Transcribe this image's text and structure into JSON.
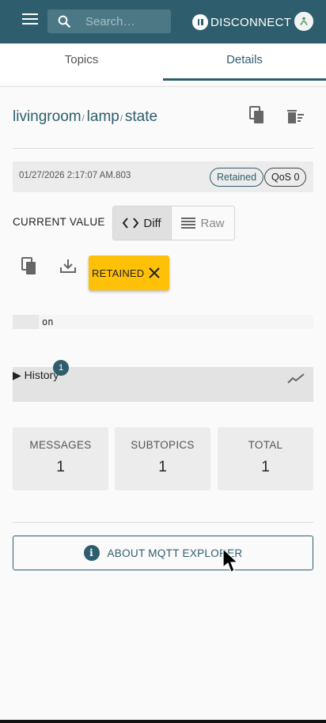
{
  "header": {
    "search_placeholder": "Search…",
    "disconnect_label": "DISCONNECT"
  },
  "tabs": [
    {
      "label": "Topics",
      "active": false
    },
    {
      "label": "Details",
      "active": true
    }
  ],
  "topic": {
    "segments": [
      "livingroom",
      "lamp",
      "state"
    ],
    "separator": "/"
  },
  "message": {
    "timestamp": "01/27/2026 2:17:07 AM.803",
    "retained_chip": "Retained",
    "qos_chip": "QoS 0"
  },
  "value_section": {
    "label": "CURRENT VALUE",
    "diff_label": "Diff",
    "raw_label": "Raw",
    "retained_button": "RETAINED",
    "value": "on"
  },
  "history": {
    "label": "History",
    "count": "1"
  },
  "stats": [
    {
      "title": "MESSAGES",
      "value": "1"
    },
    {
      "title": "SUBTOPICS",
      "value": "1"
    },
    {
      "title": "TOTAL",
      "value": "1"
    }
  ],
  "about_label": "ABOUT MQTT EXPLORER",
  "colors": {
    "primary": "#2e5e6d",
    "retained_button": "#ffc107"
  }
}
